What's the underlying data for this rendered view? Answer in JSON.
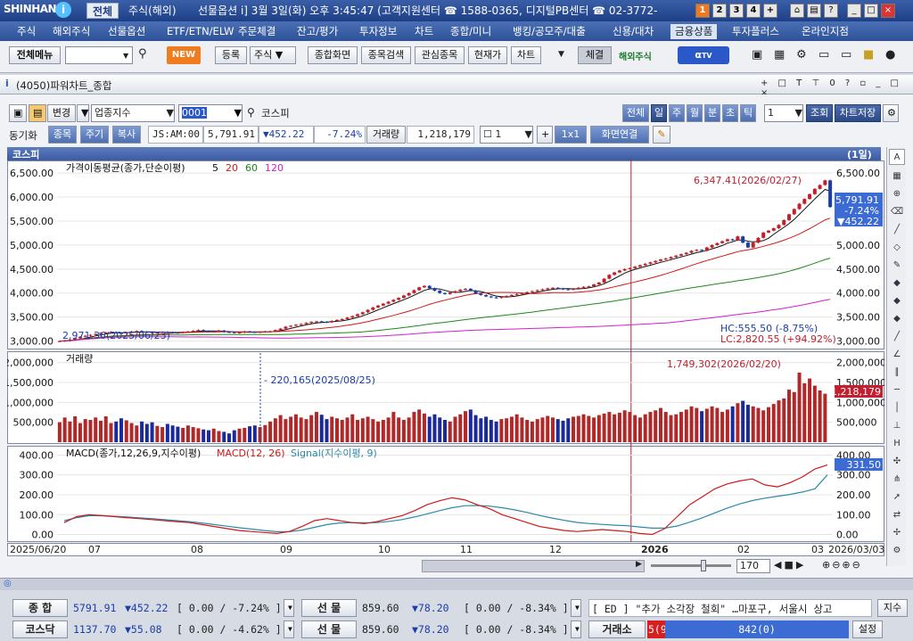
{
  "app": {
    "logo": "SHINHAN",
    "logo_mark": "i"
  },
  "top_tabs": [
    {
      "label": "전체"
    },
    {
      "label": "주식(해외)"
    }
  ],
  "ticker": "선물옵션 i] 3월 3일(화) 오후 3:45:47 (고객지원센터 ☎ 1588-0365, 디지털PB센터 ☎ 02-3772-",
  "num_buttons": [
    "1",
    "2",
    "3",
    "4",
    "+"
  ],
  "menu": [
    "주식",
    "해외주식",
    "선물옵션",
    "ETF/ETN/ELW",
    "주문체결",
    "잔고/평가",
    "투자정보",
    "차트",
    "종합/미니",
    "뱅킹/공모주/대출",
    "신용/대차",
    "금융상품",
    "투자플러스",
    "온라인지점"
  ],
  "toolbar": {
    "all_menu": "전체메뉴",
    "new_badge": "NEW",
    "register": "등록",
    "category": "주식",
    "combined": "종합화면",
    "search": "종목검색",
    "watch": "관심종목",
    "price": "현재가",
    "chart": "차트",
    "execute": "체결",
    "overseas": "해외주식",
    "tv": "TV"
  },
  "window_title": "(4050)파워차트_종합",
  "controls": {
    "change": "변경",
    "index_type": "업종지수",
    "code": "0001",
    "name": "코스피",
    "periods": [
      "전체",
      "일",
      "주",
      "월",
      "분",
      "초",
      "틱"
    ],
    "period_count": "1",
    "query": "조회",
    "save": "차트저장"
  },
  "sync": {
    "label": "동기화",
    "tabs": [
      "종목",
      "주기",
      "복사"
    ],
    "code": "JS:AM:00",
    "price": "5,791.91",
    "change": "▼452.22",
    "rate": "-7.24%",
    "volume_label": "거래량",
    "volume": "1,218,179",
    "layout_num": "1",
    "grid": "1x1",
    "link": "화면연결"
  },
  "chart_header": {
    "name": "코스피",
    "period": "(1일)"
  },
  "price_panel": {
    "legend": "가격이동평균(종가,단순이평)",
    "ma": [
      "5",
      "20",
      "60",
      "120"
    ],
    "yticks": [
      "6,500.00",
      "6,000.00",
      "5,500.00",
      "5,000.00",
      "4,500.00",
      "4,000.00",
      "3,500.00",
      "3,000.00"
    ],
    "high_label": "6,347.41(2026/02/27)",
    "low_label": "2,971.36(2025/06/23)",
    "hc": "HC:555.50 (-8.75%)",
    "lc": "LC:2,820.55 (+94.92%)",
    "current": [
      "5,791.91",
      "-7.24%",
      "▼452.22"
    ]
  },
  "volume_panel": {
    "legend": "거래량",
    "yticks": [
      "2,000,000",
      "1,500,000",
      "1,000,000",
      "500,000"
    ],
    "high_label": "1,749,302(2026/02/20)",
    "low_label": "220,165(2025/08/25)",
    "current": "1,218,179"
  },
  "macd_panel": {
    "legend": "MACD(종가,12,26,9,지수이평)",
    "macd_label": "MACD(12, 26)",
    "signal_label": "Signal(지수이평, 9)",
    "yticks": [
      "400.00",
      "300.00",
      "200.00",
      "100.00",
      "0.00"
    ],
    "current": "331.50"
  },
  "x_axis": {
    "start": "2025/06/20",
    "end": "2026/03/03",
    "labels": [
      "07",
      "08",
      "09",
      "10",
      "11",
      "12",
      "2026",
      "02",
      "03"
    ]
  },
  "scroll": {
    "count": "170"
  },
  "colors": {
    "up": "#c0202a",
    "down": "#1a3ea8",
    "ma5": "#111111",
    "ma20": "#d01818",
    "ma60": "#1a8a1a",
    "ma120": "#d020d0",
    "macd": "#d01818",
    "signal": "#2a8aaa"
  },
  "status": {
    "row1": {
      "label": "종   합",
      "val": "5791.91",
      "chg": "▼452.22",
      "box": "[ 0.00  /  -7.24% ]",
      "fut_label": "선   물",
      "fut": "859.60",
      "fut_chg": "▼78.20",
      "fut_box": "[ 0.00  /  -8.34% ]",
      "news": "[ ED ]  \"추가 소각장 철회\" …마포구, 서울시 상고",
      "news_btn": "지수"
    },
    "row2": {
      "label": "코스닥",
      "val": "1137.70",
      "chg": "▼55.08",
      "box": "[ 0.00  /  -4.62% ]",
      "fut_label": "선   물",
      "fut": "859.60",
      "fut_chg": "▼78.20",
      "fut_box": "[ 0.00  /  -8.34% ]",
      "exch_label": "거래소",
      "exch_a": "5(9",
      "exch_b": "842(0)",
      "settings": "설정"
    }
  },
  "chart_data": {
    "type": "candlestick",
    "x_range": [
      "2025/06/20",
      "2026/03/03"
    ],
    "price_ylim": [
      2900,
      6650
    ],
    "volume_ylim": [
      0,
      2150000
    ],
    "macd_ylim": [
      -20,
      420
    ],
    "close": [
      3000,
      3010,
      3030,
      3060,
      3090,
      3110,
      3130,
      3150,
      3170,
      3180,
      3190,
      3170,
      3165,
      3180,
      3200,
      3210,
      3195,
      3185,
      3170,
      3180,
      3190,
      3185,
      3175,
      3170,
      3190,
      3200,
      3215,
      3230,
      3210,
      3195,
      3200,
      3220,
      3190,
      3185,
      3170,
      3180,
      3200,
      3190,
      3185,
      3190,
      3200,
      3205,
      3230,
      3260,
      3300,
      3320,
      3340,
      3355,
      3380,
      3400,
      3410,
      3400,
      3390,
      3420,
      3440,
      3460,
      3490,
      3520,
      3560,
      3600,
      3650,
      3700,
      3740,
      3780,
      3820,
      3860,
      3900,
      3950,
      4000,
      4060,
      4120,
      4150,
      4100,
      4050,
      4000,
      3980,
      4010,
      4040,
      4070,
      4090,
      4050,
      3990,
      3960,
      3930,
      3910,
      3900,
      3920,
      3940,
      3960,
      3980,
      4000,
      4020,
      4040,
      4060,
      4080,
      4100,
      4110,
      4095,
      4080,
      4070,
      4090,
      4110,
      4130,
      4140,
      4180,
      4220,
      4300,
      4380,
      4430,
      4470,
      4500,
      4520,
      4550,
      4580,
      4610,
      4640,
      4670,
      4700,
      4720,
      4750,
      4780,
      4810,
      4840,
      4880,
      4900,
      4880,
      4950,
      5000,
      5040,
      5080,
      5120,
      5100,
      5180,
      5050,
      4950,
      5050,
      5150,
      5260,
      5300,
      5350,
      5420,
      5520,
      5640,
      5750,
      5860,
      5960,
      6060,
      6170,
      6250,
      6347,
      5792
    ],
    "volume": [
      500000,
      620000,
      520000,
      650000,
      480000,
      580000,
      560000,
      620000,
      540000,
      650000,
      480000,
      520000,
      600000,
      550000,
      480000,
      420000,
      520000,
      460000,
      500000,
      410000,
      380000,
      460000,
      420000,
      390000,
      360000,
      420000,
      380000,
      350000,
      320000,
      300000,
      340000,
      280000,
      260000,
      220165,
      300000,
      340000,
      360000,
      400000,
      420000,
      380000,
      430000,
      520000,
      600000,
      680000,
      580000,
      640000,
      700000,
      620000,
      580000,
      680000,
      760000,
      690000,
      580000,
      640000,
      600000,
      560000,
      620000,
      700000,
      560000,
      600000,
      640000,
      580000,
      520000,
      560000,
      620000,
      760000,
      620000,
      560000,
      620000,
      760000,
      820000,
      720000,
      640000,
      700000,
      620000,
      560000,
      520000,
      640000,
      700000,
      780000,
      820000,
      680000,
      600000,
      640000,
      560000,
      520000,
      580000,
      600000,
      640000,
      700000,
      620000,
      560000,
      520000,
      580000,
      620000,
      660000,
      620000,
      580000,
      540000,
      600000,
      640000,
      660000,
      700000,
      660000,
      620000,
      680000,
      720000,
      760000,
      700000,
      740000,
      800000,
      760000,
      680000,
      620000,
      700000,
      760000,
      800000,
      860000,
      760000,
      680000,
      700000,
      760000,
      820000,
      900000,
      860000,
      780000,
      840000,
      900000,
      860000,
      760000,
      820000,
      900000,
      980000,
      1040000,
      940000,
      900000,
      860000,
      800000,
      880000,
      960000,
      1050000,
      1100000,
      1320000,
      1260000,
      1749302,
      1480000,
      1600000,
      1420000,
      1300000,
      1218179
    ],
    "macd": [
      60,
      90,
      100,
      95,
      90,
      85,
      80,
      75,
      70,
      65,
      60,
      50,
      40,
      30,
      20,
      15,
      10,
      5,
      15,
      40,
      70,
      80,
      70,
      60,
      55,
      65,
      80,
      95,
      120,
      150,
      170,
      185,
      175,
      150,
      130,
      100,
      80,
      60,
      40,
      30,
      20,
      15,
      20,
      25,
      20,
      15,
      5,
      0,
      30,
      90,
      150,
      190,
      230,
      255,
      270,
      280,
      250,
      240,
      260,
      290,
      330,
      350
    ],
    "signal": [
      70,
      85,
      95,
      95,
      92,
      88,
      84,
      80,
      75,
      70,
      65,
      58,
      50,
      42,
      34,
      27,
      20,
      14,
      14,
      22,
      36,
      50,
      58,
      60,
      59,
      60,
      66,
      75,
      88,
      104,
      120,
      135,
      145,
      146,
      143,
      135,
      124,
      111,
      96,
      83,
      71,
      61,
      55,
      51,
      47,
      44,
      38,
      32,
      32,
      43,
      62,
      84,
      109,
      133,
      154,
      171,
      183,
      193,
      202,
      214,
      230,
      300
    ]
  }
}
